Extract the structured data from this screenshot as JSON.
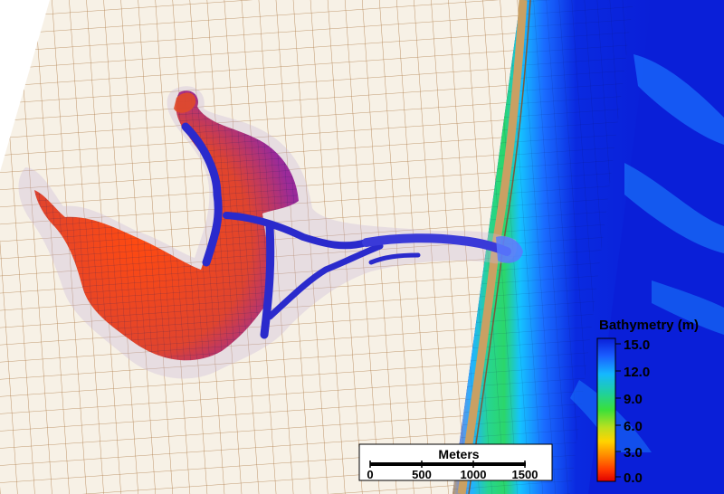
{
  "legend": {
    "title": "Bathymetry (m)",
    "ticks": [
      "15.0",
      "12.0",
      "9.0",
      "6.0",
      "3.0",
      "0.0"
    ],
    "colors": [
      "#0a1fd8",
      "#1a5cff",
      "#15b8ff",
      "#1fd0a0",
      "#3ae03a",
      "#b8e020",
      "#ffd400",
      "#ff8a00",
      "#ff3a00",
      "#e00000"
    ]
  },
  "scale_bar": {
    "title": "Meters",
    "ticks": [
      "0",
      "500",
      "1000",
      "1500"
    ]
  },
  "colors": {
    "land_grid": "#b07d4a",
    "deep_water": "#0a1fd8",
    "shallow_water": "#e04a2a",
    "channel": "#2a2acc"
  }
}
